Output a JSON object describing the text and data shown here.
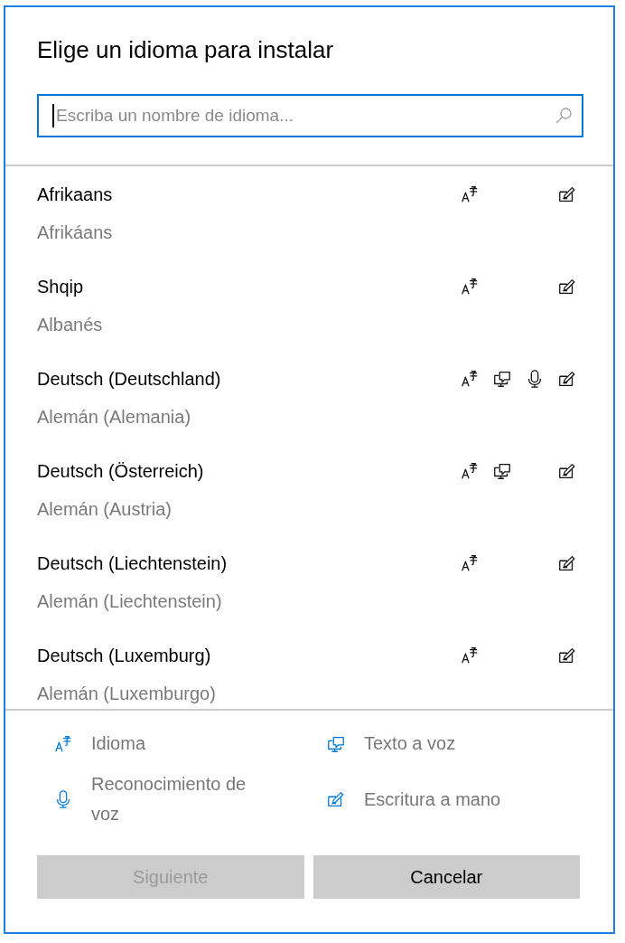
{
  "dialog": {
    "title": "Elige un idioma para instalar",
    "search": {
      "placeholder": "Escriba un nombre de idioma..."
    },
    "languages": [
      {
        "name": "Afrikaans",
        "localized": "Afrikáans",
        "features": {
          "language": true,
          "text_to_speech": false,
          "speech": false,
          "handwriting": true
        }
      },
      {
        "name": "Shqip",
        "localized": "Albanés",
        "features": {
          "language": true,
          "text_to_speech": false,
          "speech": false,
          "handwriting": true
        }
      },
      {
        "name": "Deutsch (Deutschland)",
        "localized": "Alemán (Alemania)",
        "features": {
          "language": true,
          "text_to_speech": true,
          "speech": true,
          "handwriting": true
        }
      },
      {
        "name": "Deutsch (Österreich)",
        "localized": "Alemán (Austria)",
        "features": {
          "language": true,
          "text_to_speech": true,
          "speech": false,
          "handwriting": true
        }
      },
      {
        "name": "Deutsch (Liechtenstein)",
        "localized": "Alemán (Liechtenstein)",
        "features": {
          "language": true,
          "text_to_speech": false,
          "speech": false,
          "handwriting": true
        }
      },
      {
        "name": "Deutsch (Luxemburg)",
        "localized": "Alemán (Luxemburgo)",
        "features": {
          "language": true,
          "text_to_speech": false,
          "speech": false,
          "handwriting": true
        }
      }
    ],
    "legend": [
      {
        "kind": "language",
        "label": "Idioma"
      },
      {
        "kind": "text_to_speech",
        "label": "Texto a voz"
      },
      {
        "kind": "speech",
        "label": "Reconocimiento de voz"
      },
      {
        "kind": "handwriting",
        "label": "Escritura a mano"
      }
    ],
    "buttons": [
      {
        "label": "Siguiente",
        "disabled": true
      },
      {
        "label": "Cancelar",
        "disabled": false
      }
    ]
  }
}
